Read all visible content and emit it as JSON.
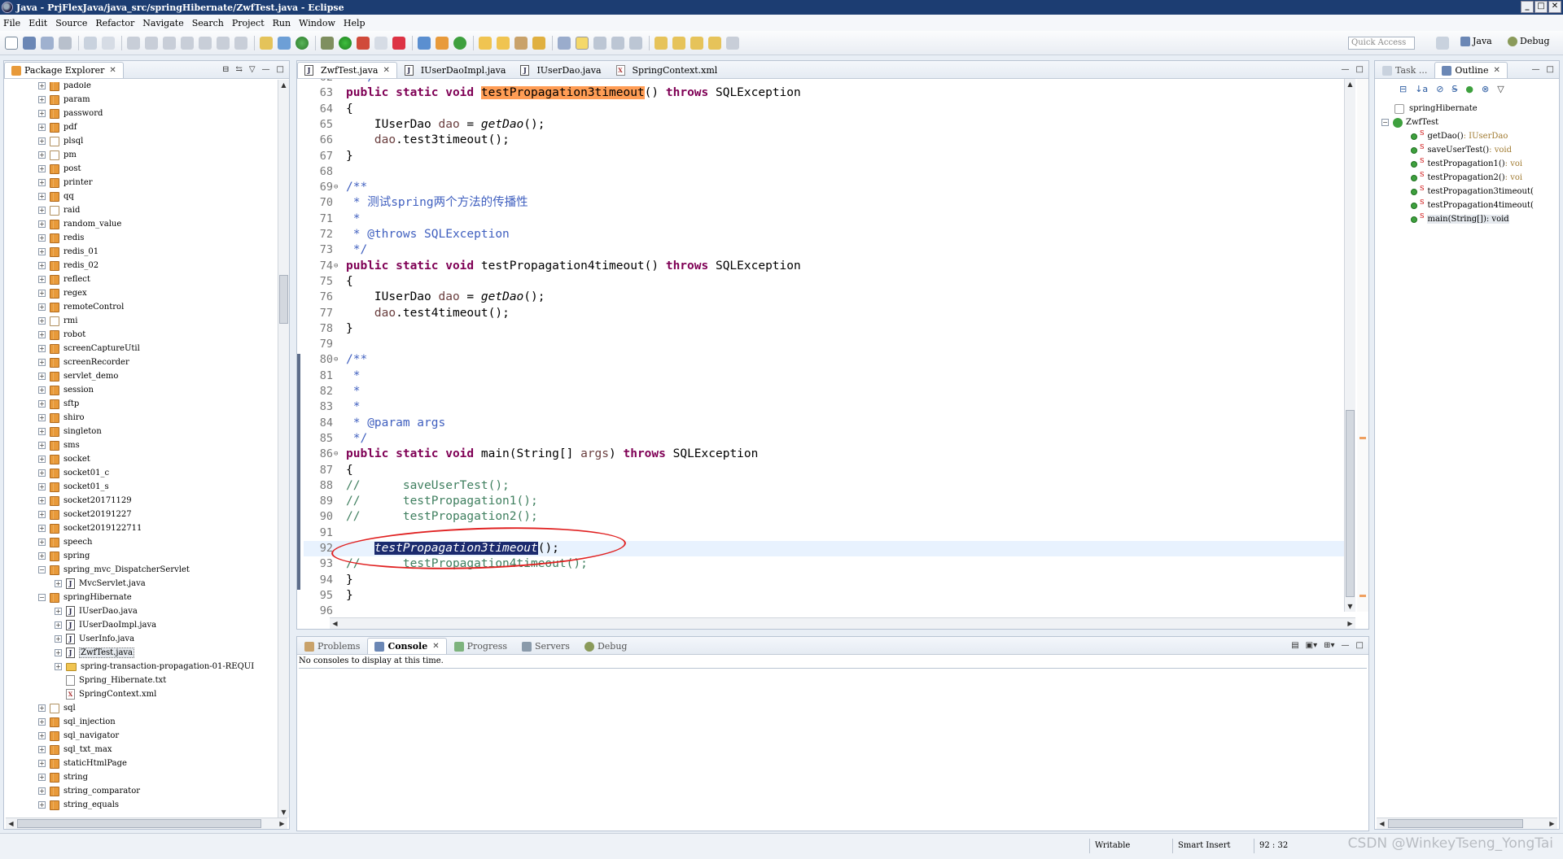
{
  "window": {
    "title": "Java - PrjFlexJava/java_src/springHibernate/ZwfTest.java - Eclipse",
    "buttons": [
      "_",
      "□",
      "✕"
    ]
  },
  "menu": [
    "File",
    "Edit",
    "Source",
    "Refactor",
    "Navigate",
    "Search",
    "Project",
    "Run",
    "Window",
    "Help"
  ],
  "toolbar": {
    "quick_access_placeholder": "Quick Access",
    "perspective_java": "Java",
    "perspective_debug": "Debug"
  },
  "package_explorer": {
    "title": "Package Explorer",
    "items": [
      {
        "label": "padole",
        "level": 0,
        "icon": "package-icon"
      },
      {
        "label": "param",
        "level": 0,
        "icon": "package-icon"
      },
      {
        "label": "password",
        "level": 0,
        "icon": "package-icon"
      },
      {
        "label": "pdf",
        "level": 0,
        "icon": "package-icon"
      },
      {
        "label": "plsql",
        "level": 0,
        "icon": "package-empty-icon"
      },
      {
        "label": "pm",
        "level": 0,
        "icon": "package-empty-icon"
      },
      {
        "label": "post",
        "level": 0,
        "icon": "package-icon"
      },
      {
        "label": "printer",
        "level": 0,
        "icon": "package-icon"
      },
      {
        "label": "qq",
        "level": 0,
        "icon": "package-icon"
      },
      {
        "label": "raid",
        "level": 0,
        "icon": "package-empty-icon"
      },
      {
        "label": "random_value",
        "level": 0,
        "icon": "package-icon"
      },
      {
        "label": "redis",
        "level": 0,
        "icon": "package-icon"
      },
      {
        "label": "redis_01",
        "level": 0,
        "icon": "package-icon"
      },
      {
        "label": "redis_02",
        "level": 0,
        "icon": "package-icon"
      },
      {
        "label": "reflect",
        "level": 0,
        "icon": "package-icon"
      },
      {
        "label": "regex",
        "level": 0,
        "icon": "package-icon"
      },
      {
        "label": "remoteControl",
        "level": 0,
        "icon": "package-icon"
      },
      {
        "label": "rmi",
        "level": 0,
        "icon": "package-empty-icon"
      },
      {
        "label": "robot",
        "level": 0,
        "icon": "package-icon"
      },
      {
        "label": "screenCaptureUtil",
        "level": 0,
        "icon": "package-icon"
      },
      {
        "label": "screenRecorder",
        "level": 0,
        "icon": "package-icon"
      },
      {
        "label": "servlet_demo",
        "level": 0,
        "icon": "package-icon"
      },
      {
        "label": "session",
        "level": 0,
        "icon": "package-icon"
      },
      {
        "label": "sftp",
        "level": 0,
        "icon": "package-icon"
      },
      {
        "label": "shiro",
        "level": 0,
        "icon": "package-icon"
      },
      {
        "label": "singleton",
        "level": 0,
        "icon": "package-icon"
      },
      {
        "label": "sms",
        "level": 0,
        "icon": "package-icon"
      },
      {
        "label": "socket",
        "level": 0,
        "icon": "package-icon"
      },
      {
        "label": "socket01_c",
        "level": 0,
        "icon": "package-icon"
      },
      {
        "label": "socket01_s",
        "level": 0,
        "icon": "package-icon"
      },
      {
        "label": "socket20171129",
        "level": 0,
        "icon": "package-icon"
      },
      {
        "label": "socket20191227",
        "level": 0,
        "icon": "package-icon"
      },
      {
        "label": "socket2019122711",
        "level": 0,
        "icon": "package-icon"
      },
      {
        "label": "speech",
        "level": 0,
        "icon": "package-icon"
      },
      {
        "label": "spring",
        "level": 0,
        "icon": "package-icon"
      },
      {
        "label": "spring_mvc_DispatcherServlet",
        "level": 0,
        "icon": "package-icon",
        "expanded": true
      },
      {
        "label": "MvcServlet.java",
        "level": 1,
        "icon": "java-file-icon"
      },
      {
        "label": "springHibernate",
        "level": 0,
        "icon": "package-icon",
        "expanded": true
      },
      {
        "label": "IUserDao.java",
        "level": 1,
        "icon": "java-file-icon"
      },
      {
        "label": "IUserDaoImpl.java",
        "level": 1,
        "icon": "java-file-icon"
      },
      {
        "label": "UserInfo.java",
        "level": 1,
        "icon": "java-file-icon"
      },
      {
        "label": "ZwfTest.java",
        "level": 1,
        "icon": "java-file-icon",
        "selected": true
      },
      {
        "label": "spring-transaction-propagation-01-REQUI",
        "level": 1,
        "icon": "folder-icon"
      },
      {
        "label": "Spring_Hibernate.txt",
        "level": 1,
        "icon": "text-file-icon",
        "noexp": true
      },
      {
        "label": "SpringContext.xml",
        "level": 1,
        "icon": "xml-file-icon",
        "noexp": true
      },
      {
        "label": "sql",
        "level": 0,
        "icon": "package-empty-icon"
      },
      {
        "label": "sql_injection",
        "level": 0,
        "icon": "package-icon"
      },
      {
        "label": "sql_navigator",
        "level": 0,
        "icon": "package-icon"
      },
      {
        "label": "sql_txt_max",
        "level": 0,
        "icon": "package-icon"
      },
      {
        "label": "staticHtmlPage",
        "level": 0,
        "icon": "package-icon"
      },
      {
        "label": "string",
        "level": 0,
        "icon": "package-icon"
      },
      {
        "label": "string_comparator",
        "level": 0,
        "icon": "package-icon"
      },
      {
        "label": "string_equals",
        "level": 0,
        "icon": "package-icon"
      }
    ]
  },
  "editor": {
    "tabs": [
      {
        "label": "ZwfTest.java",
        "active": true
      },
      {
        "label": "IUserDaoImpl.java"
      },
      {
        "label": "IUserDao.java"
      },
      {
        "label": "SpringContext.xml"
      }
    ],
    "lines": [
      {
        "n": "62",
        "html": "<span class=\"cm\">  */</span>"
      },
      {
        "n": "63",
        "fold": "",
        "html": "<span class=\"kw\">public static void</span> <span class=\"hl-orange\">testPropagation3timeout</span>() <span class=\"kw\">throws</span> SQLException"
      },
      {
        "n": "64",
        "html": "{"
      },
      {
        "n": "65",
        "html": "    IUserDao <span class=\"fld\" style=\"color:#6a3e3e\">dao</span> = <span class=\"it\">getDao</span>();"
      },
      {
        "n": "66",
        "html": "    <span style=\"color:#6a3e3e\">dao</span>.test3timeout();"
      },
      {
        "n": "67",
        "html": "}"
      },
      {
        "n": "68",
        "html": ""
      },
      {
        "n": "69",
        "fold": "⊖",
        "html": "<span class=\"cm\">/**</span>"
      },
      {
        "n": "70",
        "html": "<span class=\"cm\"> * 测试spring两个方法的传播性</span>"
      },
      {
        "n": "71",
        "html": "<span class=\"cm\"> *</span>"
      },
      {
        "n": "72",
        "html": "<span class=\"cm\"> * @throws SQLException</span>"
      },
      {
        "n": "73",
        "html": "<span class=\"cm\"> */</span>"
      },
      {
        "n": "74",
        "fold": "⊖",
        "html": "<span class=\"kw\">public static void</span> testPropagation4timeout() <span class=\"kw\">throws</span> SQLException"
      },
      {
        "n": "75",
        "html": "{"
      },
      {
        "n": "76",
        "html": "    IUserDao <span style=\"color:#6a3e3e\">dao</span> = <span class=\"it\">getDao</span>();"
      },
      {
        "n": "77",
        "html": "    <span style=\"color:#6a3e3e\">dao</span>.test4timeout();"
      },
      {
        "n": "78",
        "html": "}"
      },
      {
        "n": "79",
        "html": ""
      },
      {
        "n": "80",
        "fold": "⊖",
        "html": "<span class=\"cm\">/**</span>"
      },
      {
        "n": "81",
        "html": "<span class=\"cm\"> *</span>"
      },
      {
        "n": "82",
        "html": "<span class=\"cm\"> *</span>"
      },
      {
        "n": "83",
        "html": "<span class=\"cm\"> *</span>"
      },
      {
        "n": "84",
        "html": "<span class=\"cm\"> * @param args</span>"
      },
      {
        "n": "85",
        "html": "<span class=\"cm\"> */</span>"
      },
      {
        "n": "86",
        "fold": "⊖",
        "html": "<span class=\"kw\">public static void</span> main(String[] <span style=\"color:#6a3e3e\">args</span>) <span class=\"kw\">throws</span> SQLException"
      },
      {
        "n": "87",
        "html": "{"
      },
      {
        "n": "88",
        "html": "<span class=\"lc\">//      saveUserTest();</span>"
      },
      {
        "n": "89",
        "html": "<span class=\"lc\">//      testPropagation1();</span>"
      },
      {
        "n": "90",
        "html": "<span class=\"lc\">//      testPropagation2();</span>"
      },
      {
        "n": "91",
        "html": ""
      },
      {
        "n": "92",
        "cur": true,
        "html": "    <span class=\"hl-sel\">testPropagation3timeout</span>();"
      },
      {
        "n": "93",
        "html": "<span class=\"lc\">//      testPropagation4timeout();</span>"
      },
      {
        "n": "94",
        "html": "}"
      },
      {
        "n": "95",
        "html": "}"
      },
      {
        "n": "96",
        "html": ""
      }
    ]
  },
  "console": {
    "tabs": [
      "Problems",
      "Console",
      "Progress",
      "Servers",
      "Debug"
    ],
    "active": "Console",
    "message": "No consoles to display at this time."
  },
  "outline": {
    "tabs": [
      "Task ...",
      "Outline"
    ],
    "items": [
      {
        "label": "springHibernate",
        "kind": "package",
        "level": 0
      },
      {
        "label": "ZwfTest",
        "kind": "class",
        "level": 0
      },
      {
        "label": "getDao()",
        "ret": " : IUserDao",
        "kind": "method",
        "level": 1
      },
      {
        "label": "saveUserTest()",
        "ret": " : void",
        "kind": "method",
        "level": 1
      },
      {
        "label": "testPropagation1()",
        "ret": " : voi",
        "kind": "method",
        "level": 1
      },
      {
        "label": "testPropagation2()",
        "ret": " : voi",
        "kind": "method",
        "level": 1
      },
      {
        "label": "testPropagation3timeout(",
        "ret": "",
        "kind": "method",
        "level": 1
      },
      {
        "label": "testPropagation4timeout(",
        "ret": "",
        "kind": "method",
        "level": 1
      },
      {
        "label": "main(String[])",
        "ret": " : void",
        "kind": "method",
        "level": 1,
        "selected": true
      }
    ]
  },
  "status": {
    "writable": "Writable",
    "insert_mode": "Smart Insert",
    "position": "92 : 32"
  },
  "watermark": "CSDN @WinkeyTseng_YongTai",
  "colors": {
    "title_bar": "#1c3d72",
    "keyword": "#7f0055",
    "javadoc": "#3f5fbf",
    "line_comment": "#3f7f5f",
    "occurrence": "#ff9d55",
    "annotation_circle": "#e02020"
  }
}
